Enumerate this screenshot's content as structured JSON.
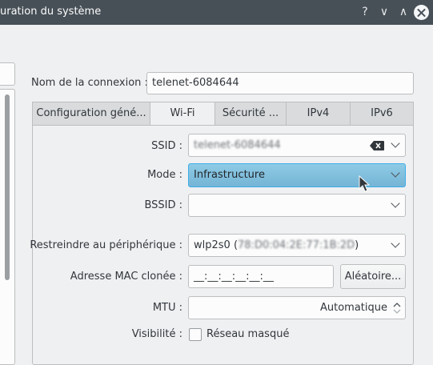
{
  "window": {
    "title": "uration du système",
    "help": "?",
    "minimize": "∨",
    "maximize": "∧"
  },
  "connection": {
    "name_label": "Nom de la connexion :",
    "name_value": "telenet-6084644"
  },
  "tabs": [
    {
      "label": "Configuration géné..."
    },
    {
      "label": "Wi-Fi"
    },
    {
      "label": "Sécurité ..."
    },
    {
      "label": "IPv4"
    },
    {
      "label": "IPv6"
    }
  ],
  "active_tab": "Wi-Fi",
  "wifi": {
    "ssid_label": "SSID :",
    "ssid_value": "telenet-6084644",
    "mode_label": "Mode :",
    "mode_value": "Infrastructure",
    "bssid_label": "BSSID :",
    "bssid_value": "",
    "restrict_label": "Restreindre au périphérique :",
    "restrict_value_prefix": "wlp2s0 (",
    "restrict_value_mac": "78:D0:04:2E:77:1B:2D",
    "restrict_value_suffix": ")",
    "mac_label": "Adresse MAC clonée :",
    "mac_value": "__:__:__:__:__:__",
    "random_button": "Aléatoire...",
    "mtu_label": "MTU :",
    "mtu_value": "Automatique",
    "visibility_label": "Visibilité :",
    "hidden_network_label": "Réseau masqué",
    "hidden_network_checked": false
  },
  "colors": {
    "titlebar": "#475057",
    "selection": "#3daee9"
  }
}
